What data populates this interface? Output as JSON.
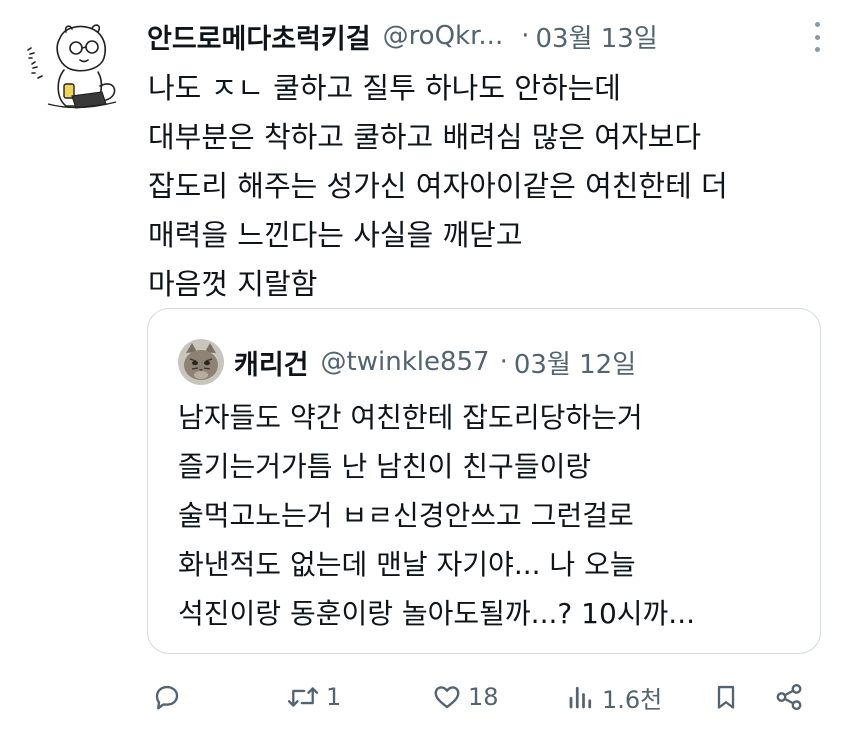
{
  "tweet": {
    "display_name": "안드로메다초럭키걸",
    "handle": "@roQkr...",
    "separator": "·",
    "date": "03월 13일",
    "lines": [
      "나도 ㅈㄴ 쿨하고 질투 하나도 안하는데",
      "대부분은 착하고 쿨하고 배려심 많은 여자보다",
      "잡도리 해주는 성가신 여자아이같은 여친한테 더",
      "매력을 느낀다는 사실을 깨닫고",
      "마음껏 지랄함"
    ]
  },
  "quote": {
    "display_name": "캐리건",
    "handle": "@twinkle857",
    "separator": "·",
    "date": "03월 12일",
    "lines": [
      "남자들도 약간 여친한테 잡도리당하는거",
      "즐기는거가틈 난 남친이 친구들이랑",
      "술먹고노는거 ㅂㄹ신경안쓰고 그런걸로",
      "화낸적도 없는데 맨날 자기야... 나 오늘",
      "석진이랑 동훈이랑 놀아도될까...? 10시까..."
    ]
  },
  "actions": {
    "reply": {
      "icon": "reply-icon",
      "count": ""
    },
    "retweet": {
      "icon": "retweet-icon",
      "count": "1"
    },
    "like": {
      "icon": "heart-icon",
      "count": "18"
    },
    "views": {
      "icon": "views-icon",
      "count": "1.6천"
    },
    "bookmark": {
      "icon": "bookmark-icon",
      "count": ""
    },
    "share": {
      "icon": "share-icon",
      "count": ""
    }
  },
  "colors": {
    "text": "#0f1419",
    "secondary": "#536471",
    "border": "#cfd9de"
  }
}
